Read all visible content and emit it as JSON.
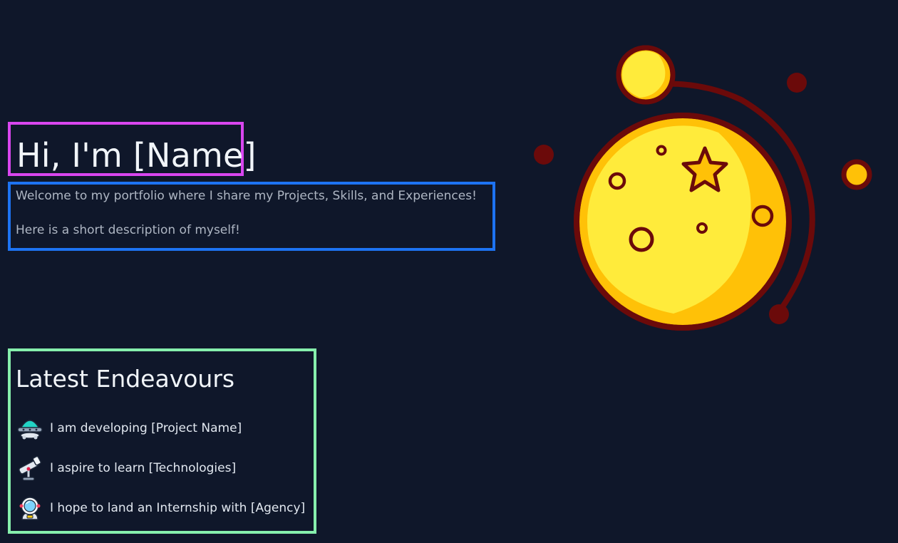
{
  "hero": {
    "title": "Hi, I'm [Name]"
  },
  "intro": {
    "line1": "Welcome to my portfolio where I share my Projects, Skills, and Experiences!",
    "line2": "Here is a short description of myself!"
  },
  "endeavours": {
    "heading": "Latest Endeavours",
    "items": [
      {
        "icon": "ufo-icon",
        "text": "I am developing [Project Name]"
      },
      {
        "icon": "telescope-icon",
        "text": "I aspire to learn [Technologies]"
      },
      {
        "icon": "astronaut-icon",
        "text": "I hope to land an Internship with [Agency]"
      }
    ]
  },
  "colors": {
    "background": "#0f172a",
    "title_outline": "#d946ef",
    "intro_outline": "#1d73f2",
    "endeavours_outline": "#86efac",
    "planet_yellow": "#ffeb3b",
    "planet_shade": "#ffc107",
    "planet_outline": "#6b0a0a"
  }
}
